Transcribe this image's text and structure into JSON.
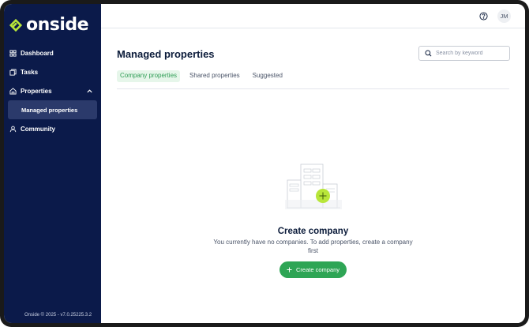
{
  "brand": {
    "name": "onside",
    "accent": "#b8e63a",
    "sidebar_bg": "#0b1a4a"
  },
  "sidebar": {
    "items": [
      {
        "label": "Dashboard",
        "icon": "dashboard-icon"
      },
      {
        "label": "Tasks",
        "icon": "tasks-icon"
      },
      {
        "label": "Properties",
        "icon": "properties-icon",
        "expanded": true,
        "children": [
          {
            "label": "Managed properties",
            "active": true
          }
        ]
      },
      {
        "label": "Community",
        "icon": "community-icon"
      }
    ],
    "version": "Onside © 2025 - v7.0.25225.3.2"
  },
  "topbar": {
    "avatar_initials": "JM",
    "help_icon": "help-circle-icon"
  },
  "page": {
    "title": "Managed properties",
    "search": {
      "placeholder": "Search by keyword",
      "value": ""
    },
    "tabs": [
      {
        "label": "Company properties",
        "active": true
      },
      {
        "label": "Shared properties",
        "active": false
      },
      {
        "label": "Suggested",
        "active": false
      }
    ]
  },
  "empty_state": {
    "title": "Create company",
    "description": "You currently have no companies. To add properties, create a company first",
    "button_label": "Create company",
    "button_icon": "plus-icon",
    "button_color": "#2ea555"
  }
}
